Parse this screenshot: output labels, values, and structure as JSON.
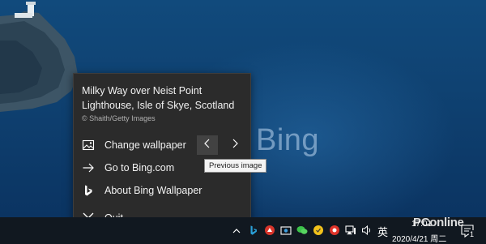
{
  "wallpaper": {
    "watermark_text": "Bing"
  },
  "flyout": {
    "caption": "Milky Way over Neist Point Lighthouse, Isle of Skye, Scotland",
    "credit": "© Shaith/Getty Images",
    "items": [
      {
        "label": "Change wallpaper",
        "icon": "image-icon"
      },
      {
        "label": "Go to Bing.com",
        "icon": "arrow-right-icon"
      },
      {
        "label": "About Bing Wallpaper",
        "icon": "bing-logo-icon"
      },
      {
        "label": "Quit",
        "icon": "close-icon"
      }
    ],
    "prev_icon": "chevron-left-icon",
    "next_icon": "chevron-right-icon",
    "tooltip": "Previous image"
  },
  "taskbar": {
    "ime_label": "英",
    "time": "17:01",
    "date": "2020/4/21 周二",
    "notification_count": "1"
  },
  "site_watermark": "PConline"
}
